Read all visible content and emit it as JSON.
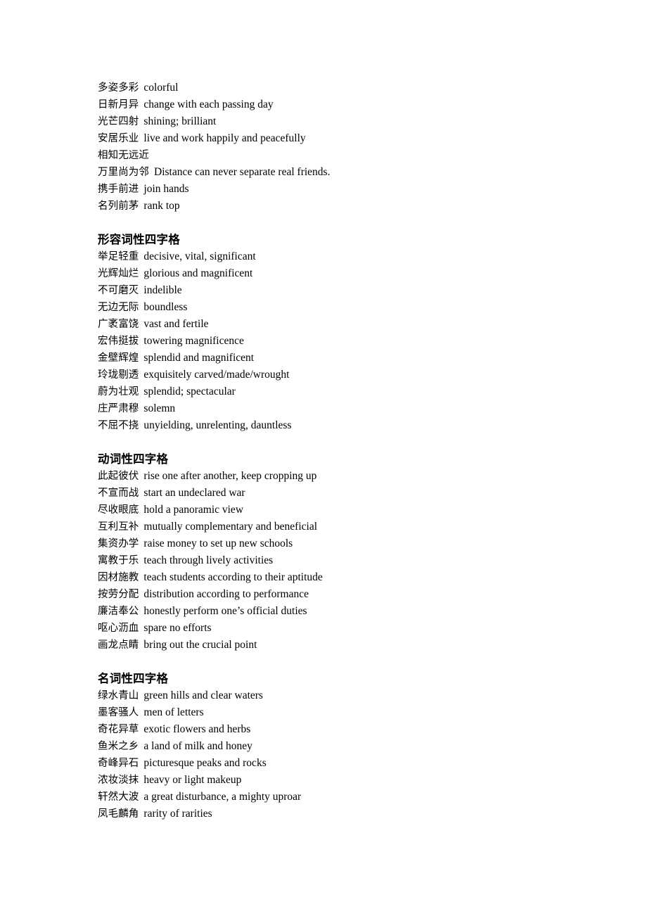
{
  "document": {
    "background_color": "#ffffff",
    "text_color": "#000000"
  },
  "sections": [
    {
      "heading": "",
      "entries": [
        {
          "term": "多姿多彩",
          "gloss": "colorful"
        },
        {
          "term": "日新月异",
          "gloss": "change with each passing day"
        },
        {
          "term": "光芒四射",
          "gloss": "shining; brilliant"
        },
        {
          "term": "安居乐业",
          "gloss": "live and work happily and peacefully"
        },
        {
          "term": "相知无远近",
          "gloss": ""
        },
        {
          "term": "万里尚为邻",
          "gloss": "Distance can never separate real friends."
        },
        {
          "term": "携手前进",
          "gloss": "join hands"
        },
        {
          "term": "名列前茅",
          "gloss": "rank top"
        }
      ]
    },
    {
      "heading": "形容词性四字格",
      "entries": [
        {
          "term": "举足轻重",
          "gloss": "decisive, vital, significant"
        },
        {
          "term": "光辉灿烂",
          "gloss": "glorious and magnificent"
        },
        {
          "term": "不可磨灭",
          "gloss": "indelible"
        },
        {
          "term": "无边无际",
          "gloss": "boundless"
        },
        {
          "term": "广袤富饶",
          "gloss": "vast and fertile"
        },
        {
          "term": "宏伟挺拔",
          "gloss": "towering magnificence"
        },
        {
          "term": "金壁辉煌",
          "gloss": "splendid and magnificent"
        },
        {
          "term": "玲珑剔透",
          "gloss": "exquisitely carved/made/wrought"
        },
        {
          "term": "蔚为壮观",
          "gloss": "splendid; spectacular"
        },
        {
          "term": "庄严肃穆",
          "gloss": "solemn"
        },
        {
          "term": "不屈不挠",
          "gloss": "unyielding, unrelenting, dauntless"
        }
      ]
    },
    {
      "heading": "动词性四字格",
      "entries": [
        {
          "term": "此起彼伏",
          "gloss": "rise one after another, keep cropping up"
        },
        {
          "term": "不宣而战",
          "gloss": "start an undeclared war"
        },
        {
          "term": "尽收眼底",
          "gloss": "hold a panoramic view"
        },
        {
          "term": "互利互补",
          "gloss": "mutually complementary and beneficial"
        },
        {
          "term": "集资办学",
          "gloss": "raise money to set up new schools"
        },
        {
          "term": "寓教于乐",
          "gloss": "teach through lively activities"
        },
        {
          "term": "因材施教",
          "gloss": "teach students according to their aptitude"
        },
        {
          "term": "按劳分配",
          "gloss": "distribution according to performance"
        },
        {
          "term": "廉洁奉公",
          "gloss": "honestly perform one’s official duties"
        },
        {
          "term": "呕心沥血",
          "gloss": "spare no efforts"
        },
        {
          "term": "画龙点睛",
          "gloss": "bring out the crucial point"
        }
      ]
    },
    {
      "heading": "名词性四字格",
      "entries": [
        {
          "term": "绿水青山",
          "gloss": "green hills and clear waters"
        },
        {
          "term": "墨客骚人",
          "gloss": "men of letters"
        },
        {
          "term": "奇花异草",
          "gloss": "exotic flowers and herbs"
        },
        {
          "term": "鱼米之乡",
          "gloss": "a land of milk and honey"
        },
        {
          "term": "奇峰异石",
          "gloss": "picturesque peaks and rocks"
        },
        {
          "term": "浓妆淡抹",
          "gloss": "heavy or light makeup"
        },
        {
          "term": "轩然大波",
          "gloss": "a great disturbance, a mighty uproar"
        },
        {
          "term": "凤毛麟角",
          "gloss": "rarity of rarities"
        }
      ]
    }
  ]
}
